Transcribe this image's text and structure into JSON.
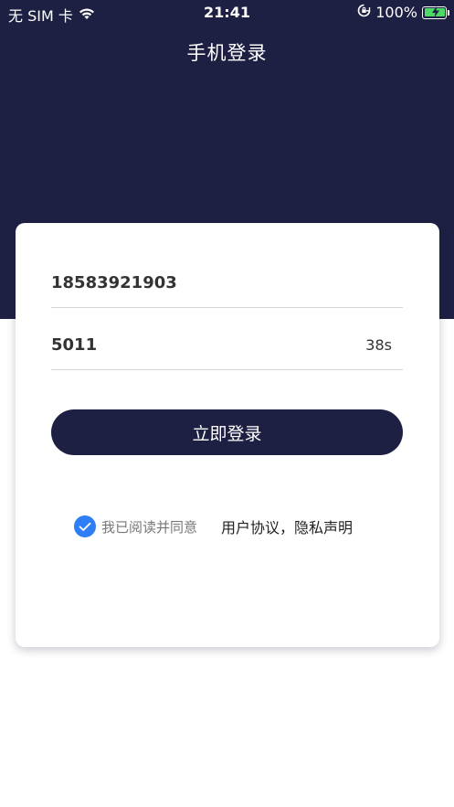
{
  "status_bar": {
    "carrier": "无 SIM 卡",
    "time": "21:41",
    "battery": "100%"
  },
  "header": {
    "title": "手机登录"
  },
  "form": {
    "phone_value": "18583921903",
    "code_value": "5011",
    "countdown": "38s",
    "login_label": "立即登录"
  },
  "agreement": {
    "checked": true,
    "prefix": "我已阅读并同意",
    "links": "用户协议，隐私声明"
  },
  "colors": {
    "primary": "#1d2042",
    "check": "#2f7ef5",
    "battery": "#4cd964"
  }
}
